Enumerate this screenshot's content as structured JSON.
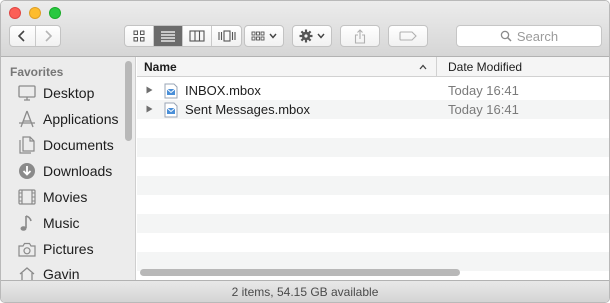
{
  "toolbar": {
    "search_placeholder": "Search"
  },
  "sidebar": {
    "section_title": "Favorites",
    "items": [
      {
        "label": "Desktop",
        "icon": "desktop-icon"
      },
      {
        "label": "Applications",
        "icon": "applications-icon"
      },
      {
        "label": "Documents",
        "icon": "documents-icon"
      },
      {
        "label": "Downloads",
        "icon": "downloads-icon"
      },
      {
        "label": "Movies",
        "icon": "movies-icon"
      },
      {
        "label": "Music",
        "icon": "music-icon"
      },
      {
        "label": "Pictures",
        "icon": "pictures-icon"
      },
      {
        "label": "Gavin",
        "icon": "home-icon"
      }
    ]
  },
  "list": {
    "columns": {
      "name": "Name",
      "date": "Date Modified"
    },
    "rows": [
      {
        "name": "INBOX.mbox",
        "date": "Today 16:41"
      },
      {
        "name": "Sent Messages.mbox",
        "date": "Today 16:41"
      }
    ]
  },
  "status": {
    "text": "2 items, 54.15 GB available"
  },
  "colors": {
    "close": "#fc5f57",
    "minimize": "#fdbc2e",
    "maximize": "#28c840",
    "active_segment": "#6b6b6b"
  }
}
